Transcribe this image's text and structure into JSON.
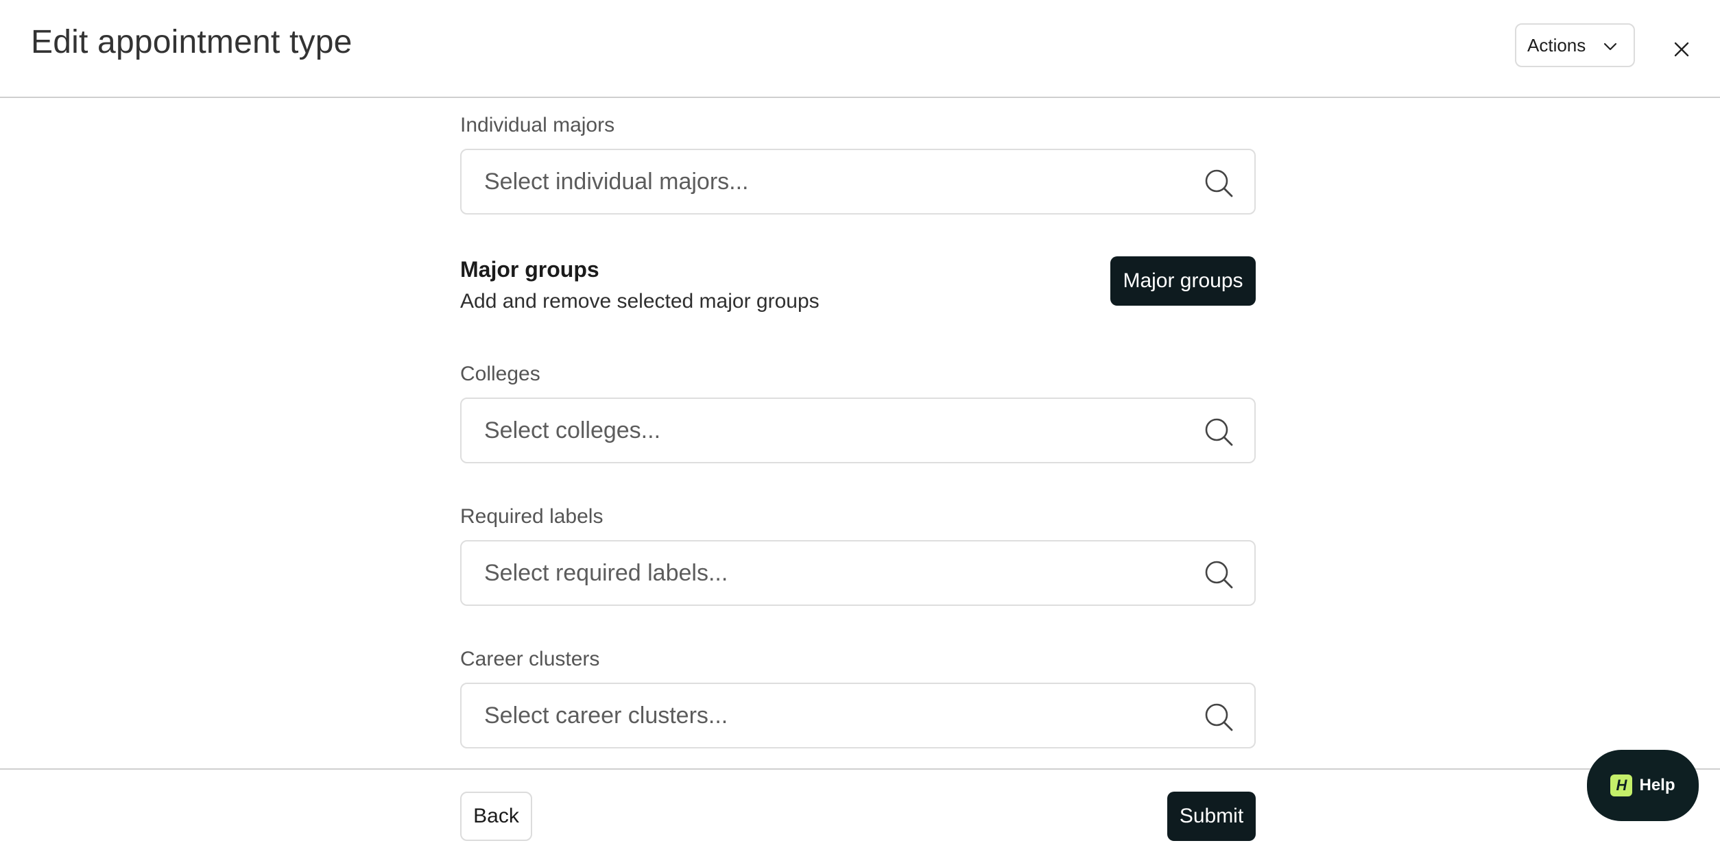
{
  "header": {
    "title": "Edit appointment type",
    "actions_label": "Actions"
  },
  "fields": {
    "individual_majors": {
      "label": "Individual majors",
      "placeholder": "Select individual majors..."
    },
    "colleges": {
      "label": "Colleges",
      "placeholder": "Select colleges..."
    },
    "required_labels": {
      "label": "Required labels",
      "placeholder": "Select required labels..."
    },
    "career_clusters": {
      "label": "Career clusters",
      "placeholder": "Select career clusters..."
    }
  },
  "major_groups": {
    "title": "Major groups",
    "description": "Add and remove selected major groups",
    "button_label": "Major groups"
  },
  "footer": {
    "back_label": "Back",
    "submit_label": "Submit"
  },
  "help": {
    "logo_text": "H",
    "label": "Help"
  },
  "icons": {
    "search": "search-icon",
    "chevron": "chevron-down-icon",
    "close": "close-icon"
  },
  "colors": {
    "primary_button": "#0e1b1f",
    "help_accent": "#c4ef6a",
    "border": "#dedede"
  }
}
